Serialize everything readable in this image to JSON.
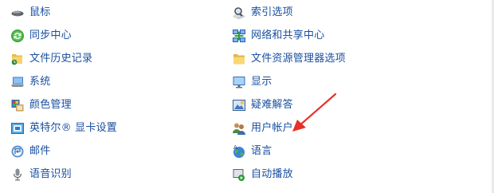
{
  "left_items": [
    {
      "label": "鼠标",
      "icon": "mouse-icon"
    },
    {
      "label": "同步中心",
      "icon": "sync-center-icon"
    },
    {
      "label": "文件历史记录",
      "icon": "file-history-icon"
    },
    {
      "label": "系统",
      "icon": "system-icon"
    },
    {
      "label": "颜色管理",
      "icon": "color-management-icon"
    },
    {
      "label": "英特尔® 显卡设置",
      "icon": "intel-graphics-icon"
    },
    {
      "label": "邮件",
      "icon": "mail-icon"
    },
    {
      "label": "语音识别",
      "icon": "microphone-icon"
    }
  ],
  "right_items": [
    {
      "label": "索引选项",
      "icon": "indexing-options-icon"
    },
    {
      "label": "网络和共享中心",
      "icon": "network-sharing-icon"
    },
    {
      "label": "文件资源管理器选项",
      "icon": "folder-options-icon"
    },
    {
      "label": "显示",
      "icon": "display-icon"
    },
    {
      "label": "疑难解答",
      "icon": "troubleshooting-icon"
    },
    {
      "label": "用户帐户",
      "icon": "user-accounts-icon"
    },
    {
      "label": "语言",
      "icon": "language-icon"
    },
    {
      "label": "自动播放",
      "icon": "autoplay-icon"
    }
  ],
  "annotation": {
    "color": "#e8302a",
    "icon": "red-arrow-icon"
  }
}
